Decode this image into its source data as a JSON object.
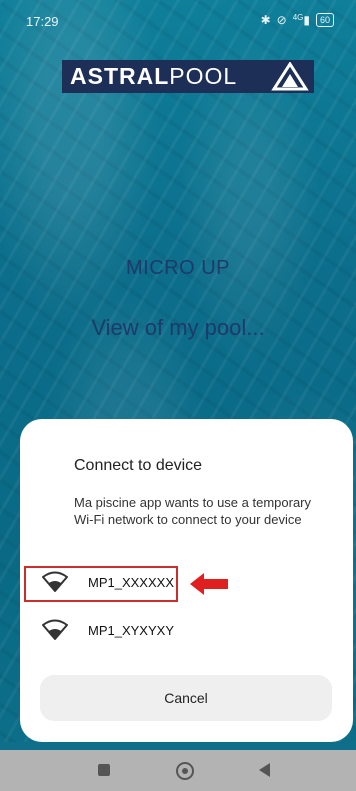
{
  "status_bar": {
    "time": "17:29",
    "network": "4G",
    "battery": "60"
  },
  "logo": {
    "brand_bold": "ASTRAL",
    "brand_light": "POOL"
  },
  "app": {
    "title": "MICRO UP",
    "subtitle": "View of my pool..."
  },
  "dialog": {
    "title": "Connect to device",
    "message": "Ma piscine app wants to use a temporary Wi-Fi network to connect to your device",
    "networks": [
      {
        "name": "MP1_XXXXXX",
        "icon": "wifi-icon",
        "highlighted": true
      },
      {
        "name": "MP1_XYXYXY",
        "icon": "wifi-icon",
        "highlighted": false
      }
    ],
    "cancel_label": "Cancel"
  },
  "annotation": {
    "arrow_color": "#e02020",
    "highlight_color": "#c9302c"
  },
  "colors": {
    "pool_water": "#0c6e8b",
    "logo_bg": "#1d2f57",
    "title_text": "#1d3a6b"
  }
}
